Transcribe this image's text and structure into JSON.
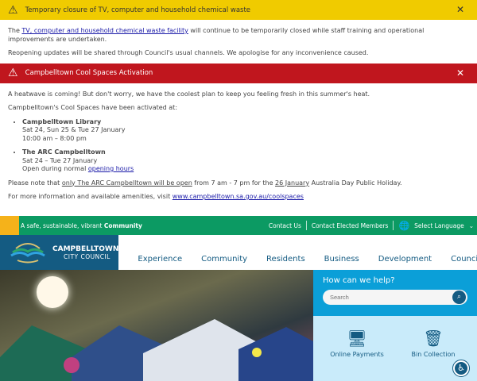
{
  "alert1": {
    "title": "Temporary closure of TV, computer and household chemical waste",
    "p1_pre": "The ",
    "p1_link": "TV, computer and household chemical waste facility",
    "p1_post": " will continue to be temporarily closed while staff training and operational improvements are undertaken.",
    "p2": "Reopening updates will be shared through Council's usual channels. We apologise for any inconvenience caused."
  },
  "alert2": {
    "title": "Campbelltown Cool Spaces Activation",
    "p1": "A heatwave is coming! But don't worry, we have the coolest plan to keep you feeling fresh in this summer's heat.",
    "p2": "Campbelltown's Cool Spaces have been activated at:",
    "places": [
      {
        "name": "Campbelltown Library",
        "l1": "Sat 24, Sun 25 & Tue 27 January",
        "l2": "10:00 am – 8:00 pm"
      },
      {
        "name": "The ARC Campbelltown",
        "l1": "Sat 24 – Tue 27 January",
        "l2_pre": "Open during normal ",
        "l2_link": "opening hours"
      }
    ],
    "note_pre": "Please note that ",
    "note_link": "only The ARC Campbelltown will be open",
    "note_mid": " from 7 am - 7 pm for the ",
    "note_link2": "26 January",
    "note_post": " Australia Day Public Holiday.",
    "more_pre": "For more information and available amenities, visit ",
    "more_link": "www.campbelltown.sa.gov.au/coolspaces"
  },
  "topbar": {
    "tag_pre": "A safe, sustainable, vibrant ",
    "tag_bold": "Community",
    "contact": "Contact Us",
    "elected": "Contact Elected Members",
    "language": "Select Language"
  },
  "logo": {
    "line1": "CAMPBELLTOWN",
    "line2": "CITY COUNCIL"
  },
  "nav": [
    "Experience",
    "Community",
    "Residents",
    "Business",
    "Development",
    "Council"
  ],
  "help": {
    "title": "How can we help?",
    "placeholder": "Search",
    "tiles": [
      "Online Payments",
      "Bin Collection"
    ]
  }
}
